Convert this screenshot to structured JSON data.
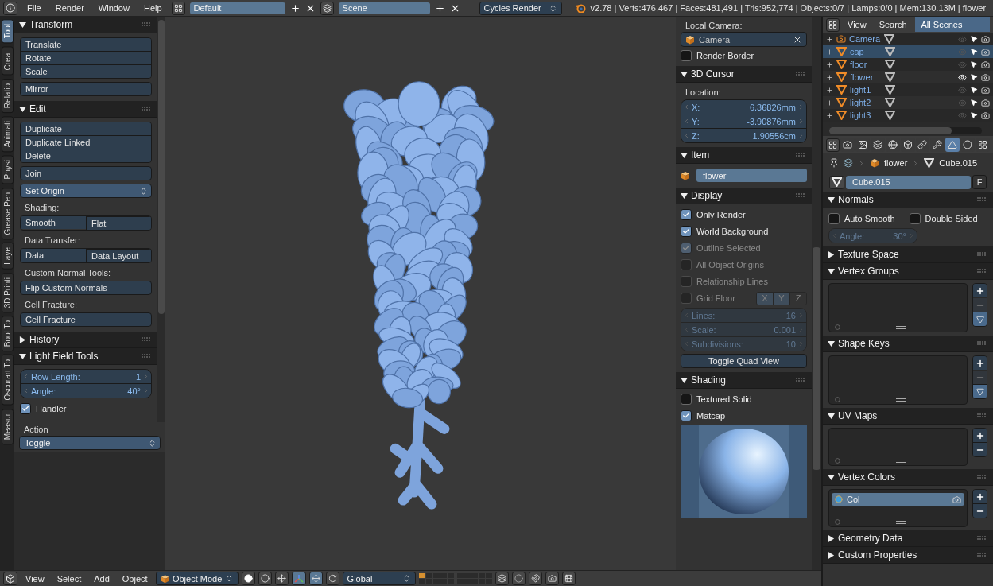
{
  "header": {
    "menus": [
      "File",
      "Render",
      "Window",
      "Help"
    ],
    "layout": "Default",
    "scene": "Scene",
    "engine": "Cycles Render",
    "stats": "v2.78 | Verts:476,467 | Faces:481,491 | Tris:952,774 | Objects:0/7 | Lamps:0/0 | Mem:130.13M | flower"
  },
  "tool_tabs": [
    {
      "label": "Tool",
      "selected": true
    },
    {
      "label": "Creat",
      "selected": false
    },
    {
      "label": "Relatio",
      "selected": false
    },
    {
      "label": "Animati",
      "selected": false
    },
    {
      "label": "Physi",
      "selected": false
    },
    {
      "label": "Grease Pen",
      "selected": false
    },
    {
      "label": "Laye",
      "selected": false
    },
    {
      "label": "3D Printi",
      "selected": false
    },
    {
      "label": "Bool To",
      "selected": false
    },
    {
      "label": "Oscurart To",
      "selected": false
    },
    {
      "label": "Measur",
      "selected": false
    }
  ],
  "tool_shelf": {
    "panels": [
      {
        "title": "Transform",
        "expanded": true,
        "items": [
          {
            "kind": "buttons",
            "labels": [
              "Translate",
              "Rotate",
              "Scale"
            ]
          },
          {
            "kind": "button",
            "label": "Mirror"
          }
        ]
      },
      {
        "title": "Edit",
        "expanded": true,
        "items": [
          {
            "kind": "buttons",
            "labels": [
              "Duplicate",
              "Duplicate Linked",
              "Delete"
            ]
          },
          {
            "kind": "button",
            "label": "Join"
          },
          {
            "kind": "dropdown",
            "value": "Set Origin"
          },
          {
            "kind": "label",
            "text": "Shading:"
          },
          {
            "kind": "row",
            "labels": [
              "Smooth",
              "Flat"
            ]
          },
          {
            "kind": "label",
            "text": "Data Transfer:"
          },
          {
            "kind": "row",
            "labels": [
              "Data",
              "Data Layout"
            ]
          },
          {
            "kind": "label",
            "text": "Custom Normal Tools:"
          },
          {
            "kind": "button",
            "label": "Flip Custom Normals"
          },
          {
            "kind": "label",
            "text": "Cell Fracture:"
          },
          {
            "kind": "button",
            "label": "Cell Fracture"
          }
        ]
      },
      {
        "title": "History",
        "expanded": false
      },
      {
        "title": "Light Field Tools",
        "expanded": true,
        "items": [
          {
            "kind": "numbers",
            "disabled": false,
            "fields": [
              {
                "label": "Row Length:",
                "value": "1"
              },
              {
                "label": "Angle:",
                "value": "40°"
              }
            ]
          },
          {
            "kind": "checkbox",
            "label": "Handler",
            "checked": true,
            "disabled": false
          }
        ]
      }
    ]
  },
  "operator": {
    "title": "Action",
    "value": "Toggle"
  },
  "n_panel": {
    "top_items": [
      {
        "kind": "label",
        "text": "Local Camera:"
      },
      {
        "kind": "object_field",
        "value": "Camera"
      },
      {
        "kind": "checkbox",
        "label": "Render Border",
        "checked": false,
        "disabled": false
      }
    ],
    "panels": [
      {
        "title": "3D Cursor",
        "expanded": true,
        "items": [
          {
            "kind": "label",
            "text": "Location:"
          },
          {
            "kind": "numbers",
            "disabled": false,
            "fields": [
              {
                "label": "X:",
                "value": "6.36826mm"
              },
              {
                "label": "Y:",
                "value": "-3.90876mm"
              },
              {
                "label": "Z:",
                "value": "1.90556cm"
              }
            ]
          }
        ]
      },
      {
        "title": "Item",
        "expanded": true,
        "items": [
          {
            "kind": "name_field",
            "value": "flower"
          }
        ]
      },
      {
        "title": "Display",
        "expanded": true,
        "items": [
          {
            "kind": "checkbox",
            "label": "Only Render",
            "checked": true,
            "disabled": false
          },
          {
            "kind": "checkbox",
            "label": "World Background",
            "checked": true,
            "disabled": false
          },
          {
            "kind": "checkbox",
            "label": "Outline Selected",
            "checked": true,
            "disabled": true
          },
          {
            "kind": "checkbox",
            "label": "All Object Origins",
            "checked": false,
            "disabled": true
          },
          {
            "kind": "checkbox",
            "label": "Relationship Lines",
            "checked": false,
            "disabled": true
          },
          {
            "kind": "checkbox",
            "label": "Grid Floor",
            "checked": false,
            "disabled": true,
            "axes": [
              {
                "label": "X",
                "selected": true
              },
              {
                "label": "Y",
                "selected": true
              },
              {
                "label": "Z",
                "selected": false
              }
            ]
          },
          {
            "kind": "numbers",
            "disabled": true,
            "fields": [
              {
                "label": "Lines:",
                "value": "16"
              },
              {
                "label": "Scale:",
                "value": "0.001"
              },
              {
                "label": "Subdivisions:",
                "value": "10"
              }
            ]
          },
          {
            "kind": "wide_button",
            "label": "Toggle Quad View"
          }
        ]
      },
      {
        "title": "Shading",
        "expanded": true,
        "items": [
          {
            "kind": "checkbox",
            "label": "Textured Solid",
            "checked": false,
            "disabled": false
          },
          {
            "kind": "checkbox",
            "label": "Matcap",
            "checked": true,
            "disabled": false
          },
          {
            "kind": "matcap"
          }
        ]
      }
    ]
  },
  "outliner": {
    "menus": [
      "View",
      "Search"
    ],
    "filter": "All Scenes",
    "items": [
      {
        "name": "Camera",
        "kind": "camera",
        "selected": false,
        "visible": false
      },
      {
        "name": "cap",
        "kind": "mesh",
        "selected": true,
        "visible": false
      },
      {
        "name": "floor",
        "kind": "mesh",
        "selected": false,
        "visible": false
      },
      {
        "name": "flower",
        "kind": "mesh",
        "selected": false,
        "visible": true
      },
      {
        "name": "light1",
        "kind": "mesh",
        "selected": false,
        "visible": false
      },
      {
        "name": "light2",
        "kind": "mesh",
        "selected": false,
        "visible": false
      },
      {
        "name": "light3",
        "kind": "mesh",
        "selected": false,
        "visible": false
      }
    ]
  },
  "properties": {
    "tabs": [
      {
        "selected": false
      },
      {
        "selected": false
      },
      {
        "selected": false
      },
      {
        "selected": false
      },
      {
        "selected": false
      },
      {
        "selected": false
      },
      {
        "selected": false
      },
      {
        "selected": true
      },
      {
        "selected": false
      },
      {
        "selected": false
      }
    ],
    "breadcrumb": [
      "flower",
      "Cube.015"
    ],
    "datablock": {
      "name": "Cube.015",
      "fake_user": "F"
    },
    "panels": [
      {
        "title": "Normals",
        "expanded": true,
        "items": [
          {
            "kind": "checkbox_pair",
            "checks": [
              {
                "label": "Auto Smooth",
                "checked": false
              },
              {
                "label": "Double Sided",
                "checked": false
              }
            ]
          },
          {
            "kind": "numbers",
            "disabled": true,
            "narrow": true,
            "fields": [
              {
                "label": "Angle:",
                "value": "30°"
              }
            ]
          }
        ]
      },
      {
        "title": "Texture Space",
        "expanded": false
      },
      {
        "title": "Vertex Groups",
        "expanded": true,
        "items": [
          {
            "kind": "list",
            "remove_disabled": true,
            "specials": true
          }
        ]
      },
      {
        "title": "Shape Keys",
        "expanded": true,
        "items": [
          {
            "kind": "list",
            "remove_disabled": true,
            "specials": true
          }
        ]
      },
      {
        "title": "UV Maps",
        "expanded": true,
        "items": [
          {
            "kind": "list",
            "remove_disabled": false,
            "specials": false
          }
        ]
      },
      {
        "title": "Vertex Colors",
        "expanded": true,
        "items": [
          {
            "kind": "list",
            "remove_disabled": false,
            "specials": false,
            "rows": [
              {
                "name": "Col",
                "selected": true
              }
            ]
          }
        ]
      },
      {
        "title": "Geometry Data",
        "expanded": false
      },
      {
        "title": "Custom Properties",
        "expanded": false
      }
    ]
  },
  "viewport_header": {
    "menus": [
      "View",
      "Select",
      "Add",
      "Object"
    ],
    "mode": "Object Mode",
    "orientation": "Global"
  }
}
